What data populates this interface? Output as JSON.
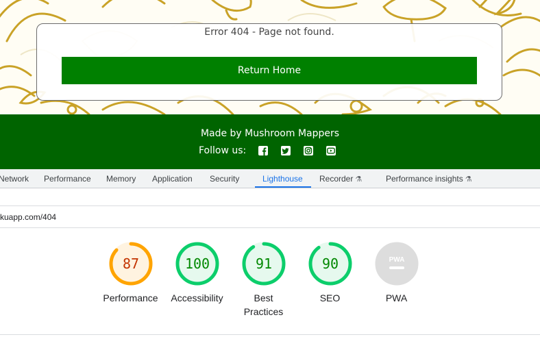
{
  "page": {
    "error_message": "Error 404 - Page not found.",
    "return_button": "Return Home"
  },
  "footer": {
    "made_by": "Made by Mushroom Mappers",
    "follow_us": "Follow us:",
    "social": [
      "facebook-icon",
      "twitter-icon",
      "instagram-icon",
      "youtube-icon"
    ]
  },
  "devtools": {
    "tabs": [
      {
        "label": "Network"
      },
      {
        "label": "Performance"
      },
      {
        "label": "Memory"
      },
      {
        "label": "Application"
      },
      {
        "label": "Security"
      },
      {
        "label": "Lighthouse"
      },
      {
        "label": "Recorder"
      },
      {
        "label": "Performance insights"
      }
    ],
    "active_tab": "Lighthouse",
    "url": "kuapp.com/404",
    "scores": [
      {
        "label": "Performance",
        "value": "87",
        "score": 0.87,
        "color": "#ffa400",
        "fill": "#fff3e0",
        "text": "#c33300"
      },
      {
        "label": "Accessibility",
        "value": "100",
        "score": 1.0,
        "color": "#0cce6b",
        "fill": "#e6f9ee",
        "text": "#008800"
      },
      {
        "label": "Best Practices",
        "value": "91",
        "score": 0.91,
        "color": "#0cce6b",
        "fill": "#e6f9ee",
        "text": "#008800"
      },
      {
        "label": "SEO",
        "value": "90",
        "score": 0.9,
        "color": "#0cce6b",
        "fill": "#e6f9ee",
        "text": "#008800"
      },
      {
        "label": "PWA",
        "value": "PWA",
        "score": null,
        "color": "#cccccc",
        "fill": "#dddddd",
        "text": "#ffffff"
      }
    ]
  },
  "colors": {
    "brand_green": "#008000",
    "footer_green": "#006400",
    "accent_blue": "#1a73e8",
    "decoration_gold": "#c9a227"
  }
}
